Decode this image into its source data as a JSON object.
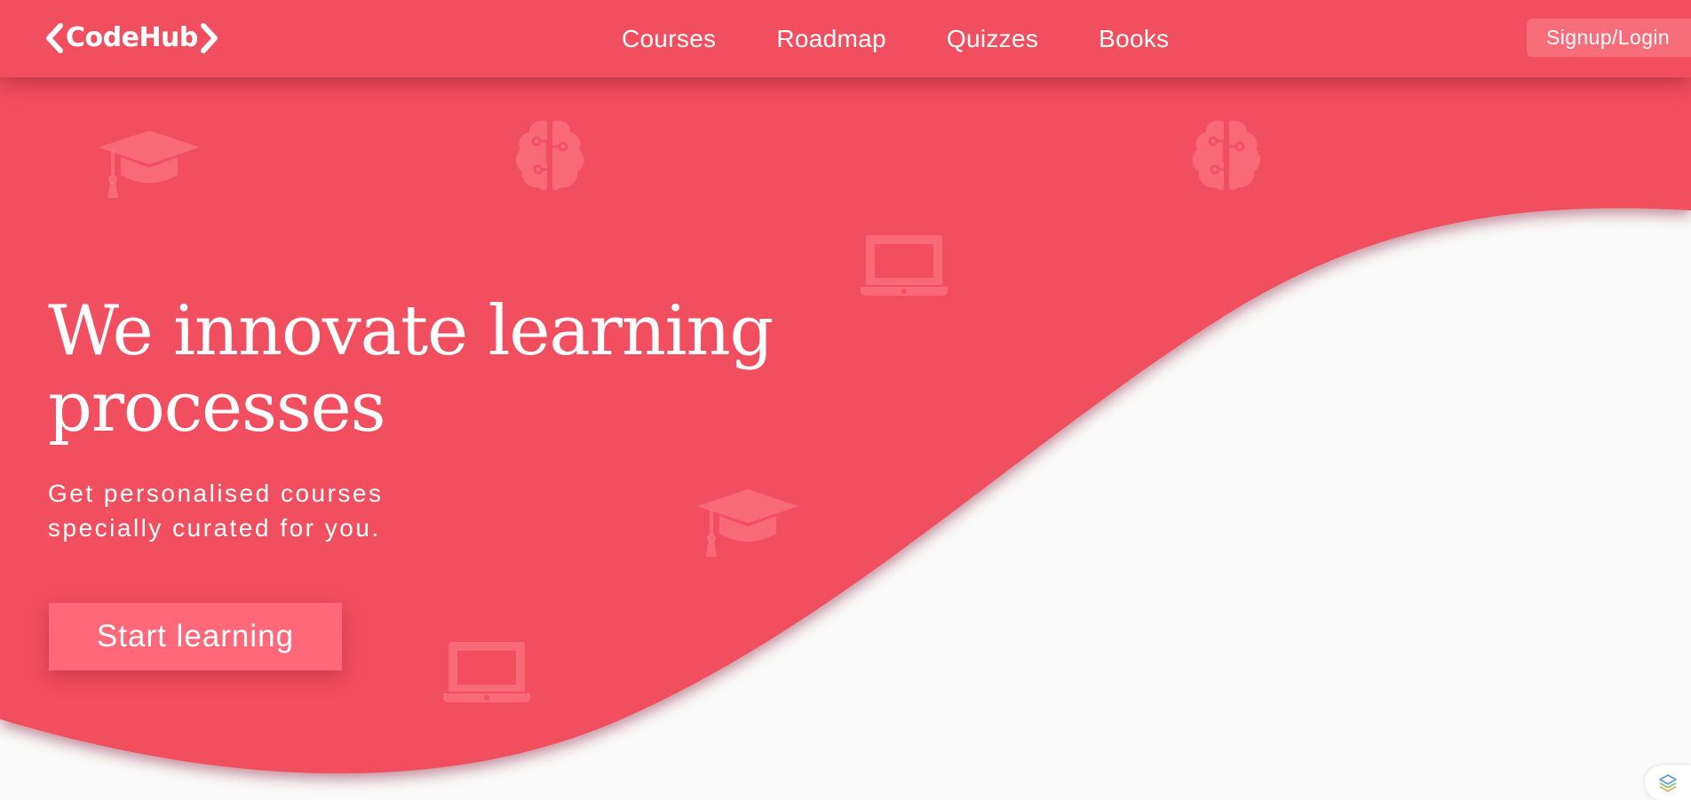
{
  "brand": {
    "name": "CodeHub",
    "logo_icon": "code-brackets-icon"
  },
  "nav": {
    "links": [
      {
        "label": "Courses"
      },
      {
        "label": "Roadmap"
      },
      {
        "label": "Quizzes"
      },
      {
        "label": "Books"
      }
    ],
    "signup_label": "Signup/Login"
  },
  "hero": {
    "headline": "We innovate learning processes",
    "subtext_line1": "Get personalised courses",
    "subtext_line2": "specially curated for you.",
    "cta_label": "Start learning",
    "background_icons": [
      "graduation-cap-icon",
      "brain-icon",
      "laptop-icon"
    ]
  },
  "colors": {
    "primary": "#f14f5f",
    "button": "#fe6878",
    "signup_button": "#f86d7a",
    "background": "#fafafa",
    "icon_overlay": "#ff7d8a"
  },
  "corner_badge": {
    "icon": "layers-icon"
  }
}
